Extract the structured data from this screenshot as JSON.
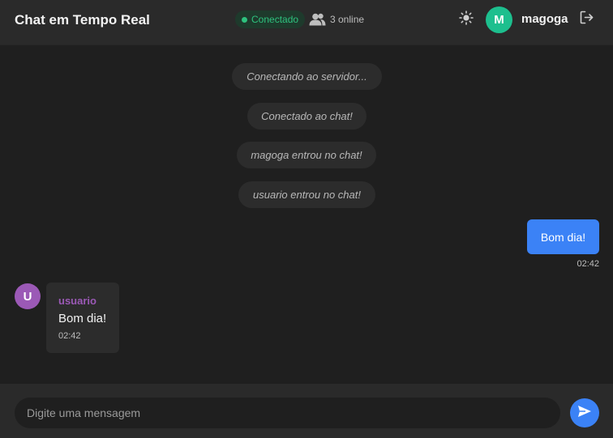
{
  "header": {
    "title": "Chat em Tempo Real",
    "status_label": "Conectado",
    "online_label": "3 online",
    "user_initial": "M",
    "username": "magoga"
  },
  "messages": {
    "system": [
      "Conectando ao servidor...",
      "Conectado ao chat!",
      "magoga entrou no chat!",
      "usuario entrou no chat!"
    ],
    "own": {
      "text": "Bom dia!",
      "time": "02:42"
    },
    "other": {
      "initial": "U",
      "author": "usuario",
      "text": "Bom dia!",
      "time": "02:42"
    }
  },
  "composer": {
    "placeholder": "Digite uma mensagem"
  },
  "colors": {
    "background": "#1f1f1f",
    "header": "#2a2a2a",
    "accent": "#3b82f6",
    "status_green": "#2ec27e",
    "own_avatar": "#1dbf8e",
    "other_avatar": "#9b59b6"
  },
  "icons": {
    "users": "users-icon",
    "theme": "sun-icon",
    "logout": "logout-icon",
    "send": "send-icon"
  }
}
